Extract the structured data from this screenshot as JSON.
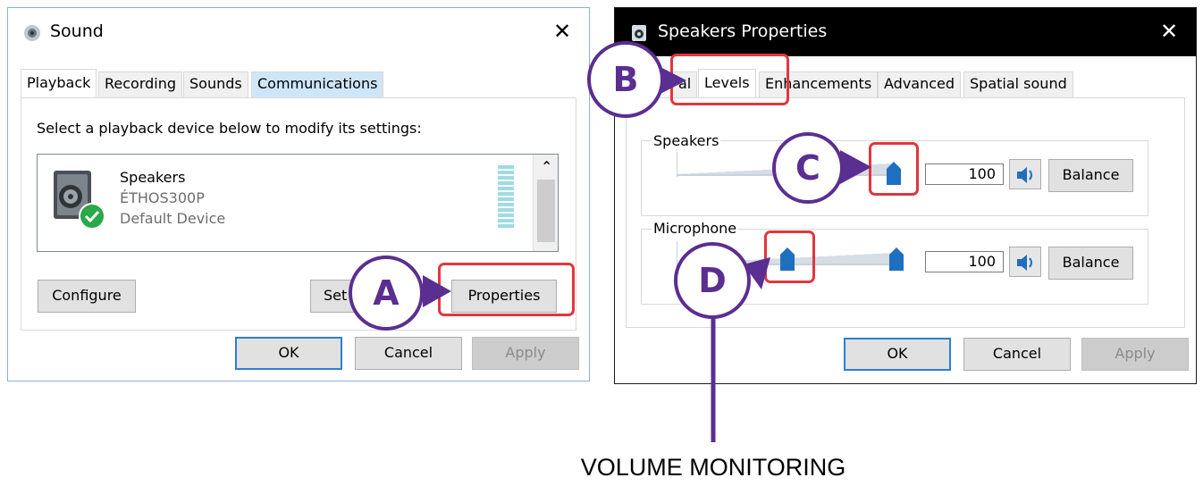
{
  "sound_window": {
    "title": "Sound",
    "close_glyph": "✕",
    "tabs": [
      "Playback",
      "Recording",
      "Sounds",
      "Communications"
    ],
    "instruction": "Select a playback device below to modify its settings:",
    "device": {
      "name": "Speakers",
      "model": "ÉTHOS300P",
      "status": "Default Device"
    },
    "scroll_up_glyph": "⌃",
    "buttons": {
      "configure": "Configure",
      "set_default": "Set",
      "properties": "Properties",
      "ok": "OK",
      "cancel": "Cancel",
      "apply": "Apply"
    }
  },
  "speakers_window": {
    "title": "Speakers Properties",
    "close_glyph": "✕",
    "tabs": [
      "al",
      "Levels",
      "Enhancements",
      "Advanced",
      "Spatial sound"
    ],
    "groups": [
      {
        "label": "Speakers",
        "value": "100",
        "balance": "Balance"
      },
      {
        "label": "Microphone",
        "value": "100",
        "balance": "Balance"
      }
    ],
    "buttons": {
      "ok": "OK",
      "cancel": "Cancel",
      "apply": "Apply"
    }
  },
  "callouts": {
    "a": "A",
    "b": "B",
    "c": "C",
    "d": "D"
  },
  "caption": "VOLUME MONITORING",
  "colors": {
    "accent_purple": "#5b2e91",
    "highlight_red": "#e0373e",
    "slider_blue": "#1f6fbf",
    "check_green": "#2aa84a"
  },
  "icons": {
    "sound_window": "speaker-icon",
    "speakers_window": "speaker-box-icon",
    "device": "speaker-device-icon",
    "default_check": "check-icon",
    "mute": "speaker-volume-icon"
  }
}
